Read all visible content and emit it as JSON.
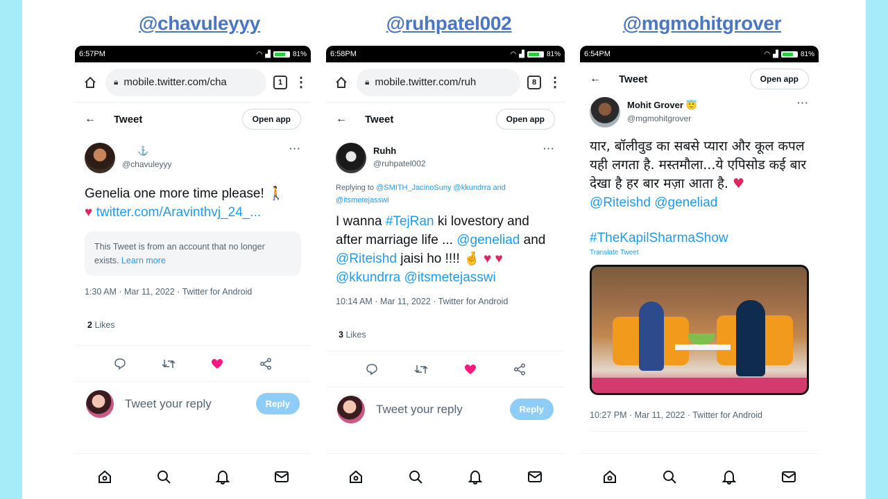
{
  "handles": [
    "@chavuleyyy",
    "@ruhpatel002",
    "@mgmohitgrover"
  ],
  "phones": [
    {
      "time": "6:57PM",
      "battery": "81%",
      "url": "mobile.twitter.com/cha",
      "tab_count": "1",
      "header_title": "Tweet",
      "open_app": "Open app",
      "author_name": "⚓",
      "author_handle": "@chavuleyyy",
      "text": "Genelia one more time please! 🚶",
      "heart": "♥",
      "link": "twitter.com/Aravinthvj_24_...",
      "notice": "This Tweet is from an account that no longer exists.",
      "notice_link": "Learn more",
      "meta": "1:30 AM · Mar 11, 2022 · Twitter for Android",
      "likes_count": "2",
      "likes_label": "Likes",
      "reply_placeholder": "Tweet your reply",
      "reply_button": "Reply"
    },
    {
      "time": "6:58PM",
      "battery": "81%",
      "url": "mobile.twitter.com/ruh",
      "tab_count": "8",
      "header_title": "Tweet",
      "open_app": "Open app",
      "author_name": "Ruhh",
      "author_handle": "@ruhpatel002",
      "replying_prefix": "Replying to",
      "replying_to": "@SMITH_JacinoSuny @kkundrra and @itsmetejasswi",
      "text_a": "I wanna ",
      "hashtag": "#TejRan",
      "text_b": "  ki lovestory and after marriage life ... ",
      "mention1": "@geneliad",
      "text_c": " and ",
      "mention2": "@Riteishd",
      "text_d": "  jaisi ho !!!! 🤞",
      "hearts": "♥ ♥",
      "mentions_line": "@kkundrra @itsmetejasswi",
      "meta": "10:14 AM · Mar 11, 2022 · Twitter for Android",
      "likes_count": "3",
      "likes_label": "Likes",
      "reply_placeholder": "Tweet your reply",
      "reply_button": "Reply"
    },
    {
      "time": "6:54PM",
      "battery": "81%",
      "header_title": "Tweet",
      "open_app": "Open app",
      "author_name": "Mohit Grover 😇",
      "author_handle": "@mgmohitgrover",
      "text": "यार, बॉलीवुड का सबसे प्यारा और कूल कपल यही लगता है. मस्तमौला...ये एपिसोड कई बार देखा है हर बार मज़ा आता है.",
      "heart": "♥",
      "mentions": "@Riteishd @geneliad",
      "hashtag": "#TheKapilSharmaShow",
      "translate": "Translate Tweet",
      "meta": "10:27 PM · Mar 11, 2022 · Twitter for Android"
    }
  ],
  "colors": {
    "twitter_blue": "#1d9bf0",
    "like_pink": "#e0245e",
    "handle_blue": "#4a76c4",
    "side_bg": "#a6ecf8"
  }
}
